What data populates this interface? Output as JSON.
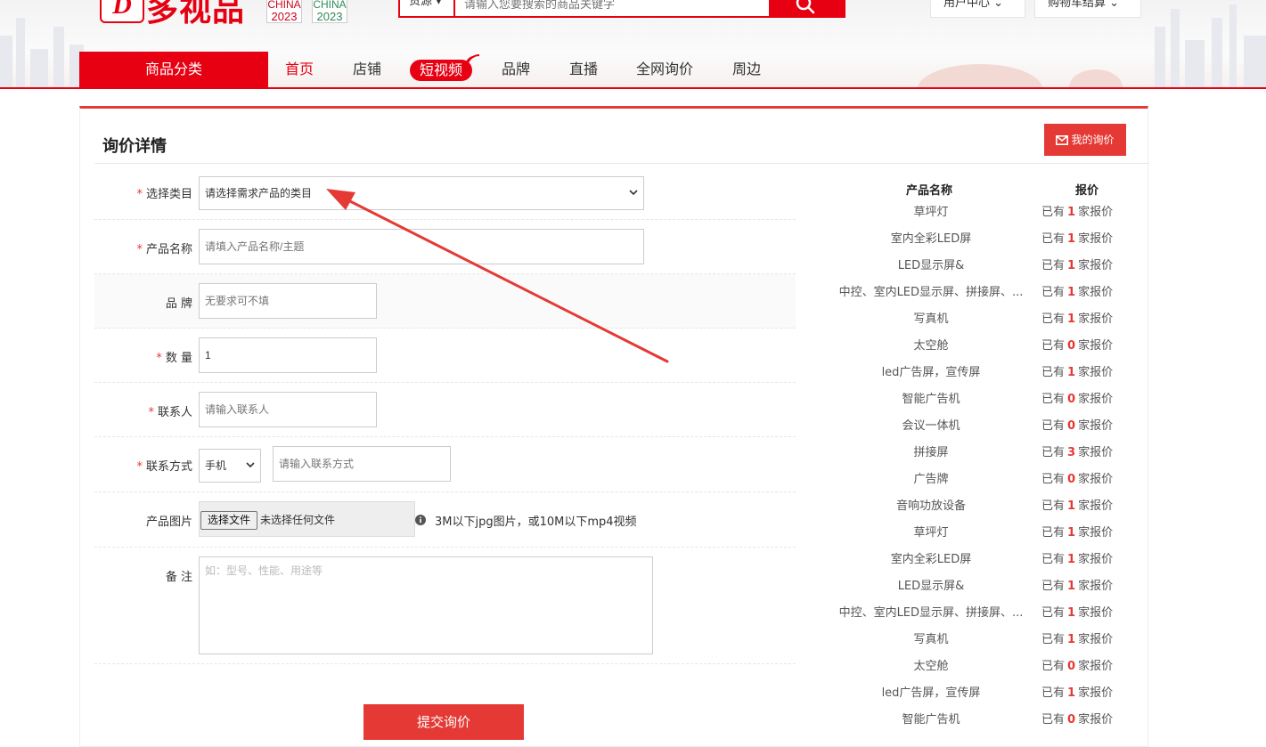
{
  "header": {
    "logo_mark": "D",
    "logo_text": "多视品",
    "badges": [
      {
        "word": "CHINA",
        "year": "2023"
      },
      {
        "word": "CHINA",
        "year": "2023"
      }
    ],
    "search": {
      "category": "货源 ▾",
      "placeholder": "请输入您要搜索的商品关键字"
    },
    "user_center": "用户中心 ⌄",
    "cart": "购物车结算 ⌄"
  },
  "nav": {
    "category_label": "商品分类",
    "items": [
      "首页",
      "店铺",
      "短视频",
      "品牌",
      "直播",
      "全网询价",
      "周边"
    ]
  },
  "page": {
    "title": "询价详情",
    "my_inquiry": "我的询价"
  },
  "form": {
    "category": {
      "label": "选择类目",
      "value": "请选择需求产品的类目"
    },
    "product_name": {
      "label": "产品名称",
      "placeholder": "请填入产品名称/主题"
    },
    "brand": {
      "label": "品 牌",
      "placeholder": "无要求可不填"
    },
    "quantity": {
      "label": "数 量",
      "value": "1"
    },
    "contact": {
      "label": "联系人",
      "placeholder": "请输入联系人"
    },
    "contact_method": {
      "label": "联系方式",
      "type_value": "手机",
      "placeholder": "请输入联系方式"
    },
    "image": {
      "label": "产品图片",
      "button": "选择文件",
      "no_file": "未选择任何文件",
      "hint": "3M以下jpg图片，或10M以下mp4视频"
    },
    "remark": {
      "label": "备 注",
      "placeholder": "如：型号、性能、用途等"
    },
    "submit": "提交询价"
  },
  "quotes": {
    "col_name": "产品名称",
    "col_quote": "报价",
    "prefix": "已有",
    "suffix": "家报价",
    "rows": [
      {
        "name": "草坪灯",
        "count": "1"
      },
      {
        "name": "室内全彩LED屏",
        "count": "1"
      },
      {
        "name": "LED显示屏&",
        "count": "1"
      },
      {
        "name": "中控、室内LED显示屏、拼接屏、...",
        "count": "1"
      },
      {
        "name": "写真机",
        "count": "1"
      },
      {
        "name": "太空舱",
        "count": "0"
      },
      {
        "name": "led广告屏，宣传屏",
        "count": "1"
      },
      {
        "name": "智能广告机",
        "count": "0"
      },
      {
        "name": "会议一体机",
        "count": "0"
      },
      {
        "name": "拼接屏",
        "count": "3"
      },
      {
        "name": "广告牌",
        "count": "0"
      },
      {
        "name": "音响功放设备",
        "count": "1"
      },
      {
        "name": "草坪灯",
        "count": "1"
      },
      {
        "name": "室内全彩LED屏",
        "count": "1"
      },
      {
        "name": "LED显示屏&",
        "count": "1"
      },
      {
        "name": "中控、室内LED显示屏、拼接屏、...",
        "count": "1"
      },
      {
        "name": "写真机",
        "count": "1"
      },
      {
        "name": "太空舱",
        "count": "0"
      },
      {
        "name": "led广告屏，宣传屏",
        "count": "1"
      },
      {
        "name": "智能广告机",
        "count": "0"
      }
    ]
  },
  "colors": {
    "brand": "#e60012",
    "accent": "#e53935"
  },
  "icons": {
    "search": "search-icon",
    "my_inquiry": "envelope-icon",
    "hint": "info-icon",
    "annotation": "arrow-annotation"
  }
}
